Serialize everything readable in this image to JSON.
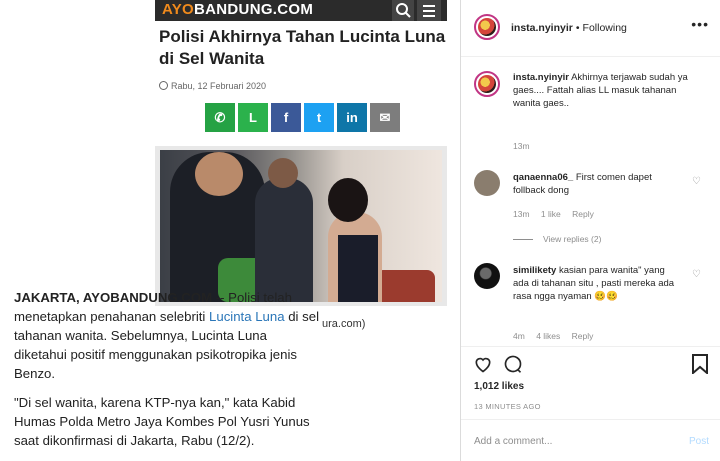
{
  "article": {
    "site_logo_left": "AYO",
    "site_logo_right": "BANDUNG.COM",
    "title": "Polisi Akhirnya Tahan Lucinta Luna di Sel Wanita",
    "date": "Rabu, 12 Februari 2020",
    "share_icons": [
      "whatsapp-icon",
      "line-icon",
      "facebook-icon",
      "twitter-icon",
      "linkedin-icon",
      "email-icon"
    ],
    "share_colors": [
      "#25a244",
      "#2bb24c",
      "#3b5998",
      "#1da1f2",
      "#0e76a8",
      "#7d7d7d"
    ],
    "share_glyphs": [
      "✆",
      "L",
      "f",
      "t",
      "in",
      "✉"
    ],
    "caption_tail": "ura.com)",
    "body": {
      "lead_bold": "JAKARTA, AYOBANDUNG.COM",
      "lead_text": " -- Polisi telah menetapkan penahanan selebriti ",
      "lead_link": "Lucinta Luna",
      "lead_rest": " di sel tahanan wanita. Sebelumnya, Lucinta Luna diketahui positif menggunakan psikotropika jenis Benzo.",
      "para2": "\"Di sel wanita, karena KTP-nya kan,\" kata Kabid Humas Polda Metro Jaya Kombes Pol Yusri Yunus saat dikonfirmasi di Jakarta, Rabu (12/2)."
    }
  },
  "instagram": {
    "header": {
      "username": "insta.nyinyir",
      "separator": "•",
      "follow_status": "Following",
      "more": "•••"
    },
    "caption": {
      "username": "insta.nyinyir",
      "text": "Akhirnya terjawab sudah ya gaes.... Fattah alias LL masuk tahanan wanita gaes..",
      "time": "13m"
    },
    "comments": [
      {
        "username": "qanaenna06_",
        "text": "First comen dapet follback dong",
        "time": "13m",
        "likes": "1 like",
        "reply": "Reply"
      },
      {
        "username": "similikety",
        "text": "kasian para wanita\" yang ada di tahanan situ , pasti mereka ada rasa ngga nyaman 🥴🥴",
        "time": "4m",
        "likes": "4 likes",
        "reply": "Reply"
      }
    ],
    "view_replies": "View replies (2)",
    "likes_count": "1,012 likes",
    "time_ago": "13 MINUTES AGO",
    "add_comment_placeholder": "Add a comment...",
    "post_label": "Post"
  }
}
